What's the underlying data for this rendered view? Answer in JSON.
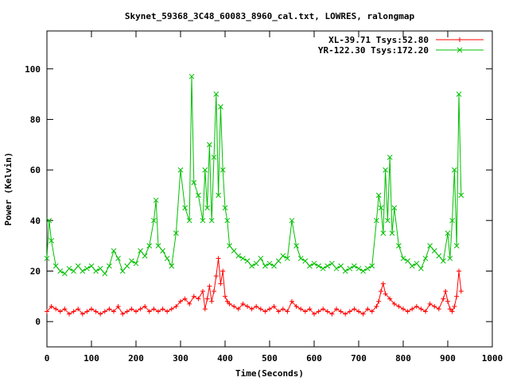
{
  "chart_data": {
    "type": "line",
    "title": "Skynet_59368_3C48_60083_8960_cal.txt, LOWRES, ralongmap",
    "xlabel": "Time(Seconds)",
    "ylabel": "Power (Kelvin)",
    "xlim": [
      0,
      1000
    ],
    "ylim": [
      -10,
      115
    ],
    "x_ticks": [
      "0",
      "100",
      "200",
      "300",
      "400",
      "500",
      "600",
      "700",
      "800",
      "900",
      "1000"
    ],
    "y_ticks": [
      "0",
      "20",
      "40",
      "60",
      "80",
      "100"
    ],
    "x_tick_values": [
      0,
      100,
      200,
      300,
      400,
      500,
      600,
      700,
      800,
      900,
      1000
    ],
    "y_tick_values": [
      0,
      20,
      40,
      60,
      80,
      100
    ],
    "grid": false,
    "legend_position": "top-right",
    "series": [
      {
        "name": "XL-39.71 Tsys:52.80",
        "color": "#ff0000",
        "marker": "plus",
        "x": [
          0,
          10,
          20,
          30,
          40,
          50,
          60,
          70,
          80,
          90,
          100,
          110,
          120,
          130,
          140,
          150,
          160,
          170,
          180,
          190,
          200,
          210,
          220,
          230,
          240,
          250,
          260,
          270,
          280,
          290,
          300,
          310,
          320,
          330,
          340,
          350,
          355,
          360,
          365,
          370,
          375,
          380,
          385,
          390,
          395,
          400,
          405,
          410,
          420,
          430,
          440,
          450,
          460,
          470,
          480,
          490,
          500,
          510,
          520,
          530,
          540,
          550,
          560,
          570,
          580,
          590,
          600,
          610,
          620,
          630,
          640,
          650,
          660,
          670,
          680,
          690,
          700,
          710,
          720,
          730,
          740,
          745,
          750,
          755,
          760,
          770,
          780,
          790,
          800,
          810,
          820,
          830,
          840,
          850,
          860,
          870,
          880,
          890,
          895,
          900,
          905,
          910,
          915,
          920,
          925,
          930
        ],
        "values": [
          4,
          6,
          5,
          4,
          5,
          3,
          4,
          5,
          3,
          4,
          5,
          4,
          3,
          4,
          5,
          4,
          6,
          3,
          4,
          5,
          4,
          5,
          6,
          4,
          5,
          4,
          5,
          4,
          5,
          6,
          8,
          9,
          7,
          10,
          9,
          12,
          5,
          9,
          14,
          8,
          12,
          18,
          25,
          15,
          20,
          10,
          8,
          7,
          6,
          5,
          7,
          6,
          5,
          6,
          5,
          4,
          5,
          6,
          4,
          5,
          4,
          8,
          6,
          5,
          4,
          5,
          3,
          4,
          5,
          4,
          3,
          5,
          4,
          3,
          4,
          5,
          4,
          3,
          5,
          4,
          6,
          8,
          12,
          15,
          11,
          9,
          7,
          6,
          5,
          4,
          5,
          6,
          5,
          4,
          7,
          6,
          5,
          9,
          12,
          8,
          5,
          4,
          6,
          10,
          20,
          12
        ]
      },
      {
        "name": "YR-122.30 Tsys:172.20",
        "color": "#00c000",
        "marker": "x",
        "x": [
          0,
          5,
          10,
          20,
          30,
          40,
          50,
          60,
          70,
          80,
          90,
          100,
          110,
          120,
          130,
          140,
          150,
          160,
          170,
          180,
          190,
          200,
          210,
          220,
          230,
          240,
          245,
          250,
          260,
          270,
          280,
          290,
          300,
          310,
          320,
          325,
          330,
          340,
          350,
          355,
          360,
          365,
          370,
          375,
          380,
          385,
          390,
          395,
          400,
          405,
          410,
          420,
          430,
          440,
          450,
          460,
          470,
          480,
          490,
          500,
          510,
          520,
          530,
          540,
          550,
          560,
          570,
          580,
          590,
          600,
          610,
          620,
          630,
          640,
          650,
          660,
          670,
          680,
          690,
          700,
          710,
          720,
          730,
          740,
          745,
          750,
          755,
          760,
          765,
          770,
          775,
          780,
          790,
          800,
          810,
          820,
          830,
          840,
          850,
          860,
          870,
          880,
          890,
          900,
          905,
          910,
          915,
          920,
          925,
          930
        ],
        "values": [
          25,
          40,
          32,
          22,
          20,
          19,
          21,
          20,
          22,
          20,
          21,
          22,
          20,
          21,
          19,
          22,
          28,
          25,
          20,
          22,
          24,
          23,
          28,
          26,
          30,
          40,
          48,
          30,
          28,
          25,
          22,
          35,
          60,
          45,
          40,
          97,
          55,
          50,
          40,
          60,
          45,
          70,
          40,
          65,
          90,
          50,
          85,
          60,
          45,
          40,
          30,
          28,
          26,
          25,
          24,
          22,
          23,
          25,
          22,
          23,
          22,
          24,
          26,
          25,
          40,
          30,
          25,
          24,
          22,
          23,
          22,
          21,
          22,
          23,
          21,
          22,
          20,
          21,
          22,
          21,
          20,
          21,
          22,
          40,
          50,
          45,
          35,
          60,
          40,
          65,
          35,
          45,
          30,
          25,
          24,
          22,
          23,
          21,
          25,
          30,
          28,
          26,
          24,
          35,
          25,
          40,
          60,
          30,
          90,
          50
        ]
      }
    ]
  }
}
